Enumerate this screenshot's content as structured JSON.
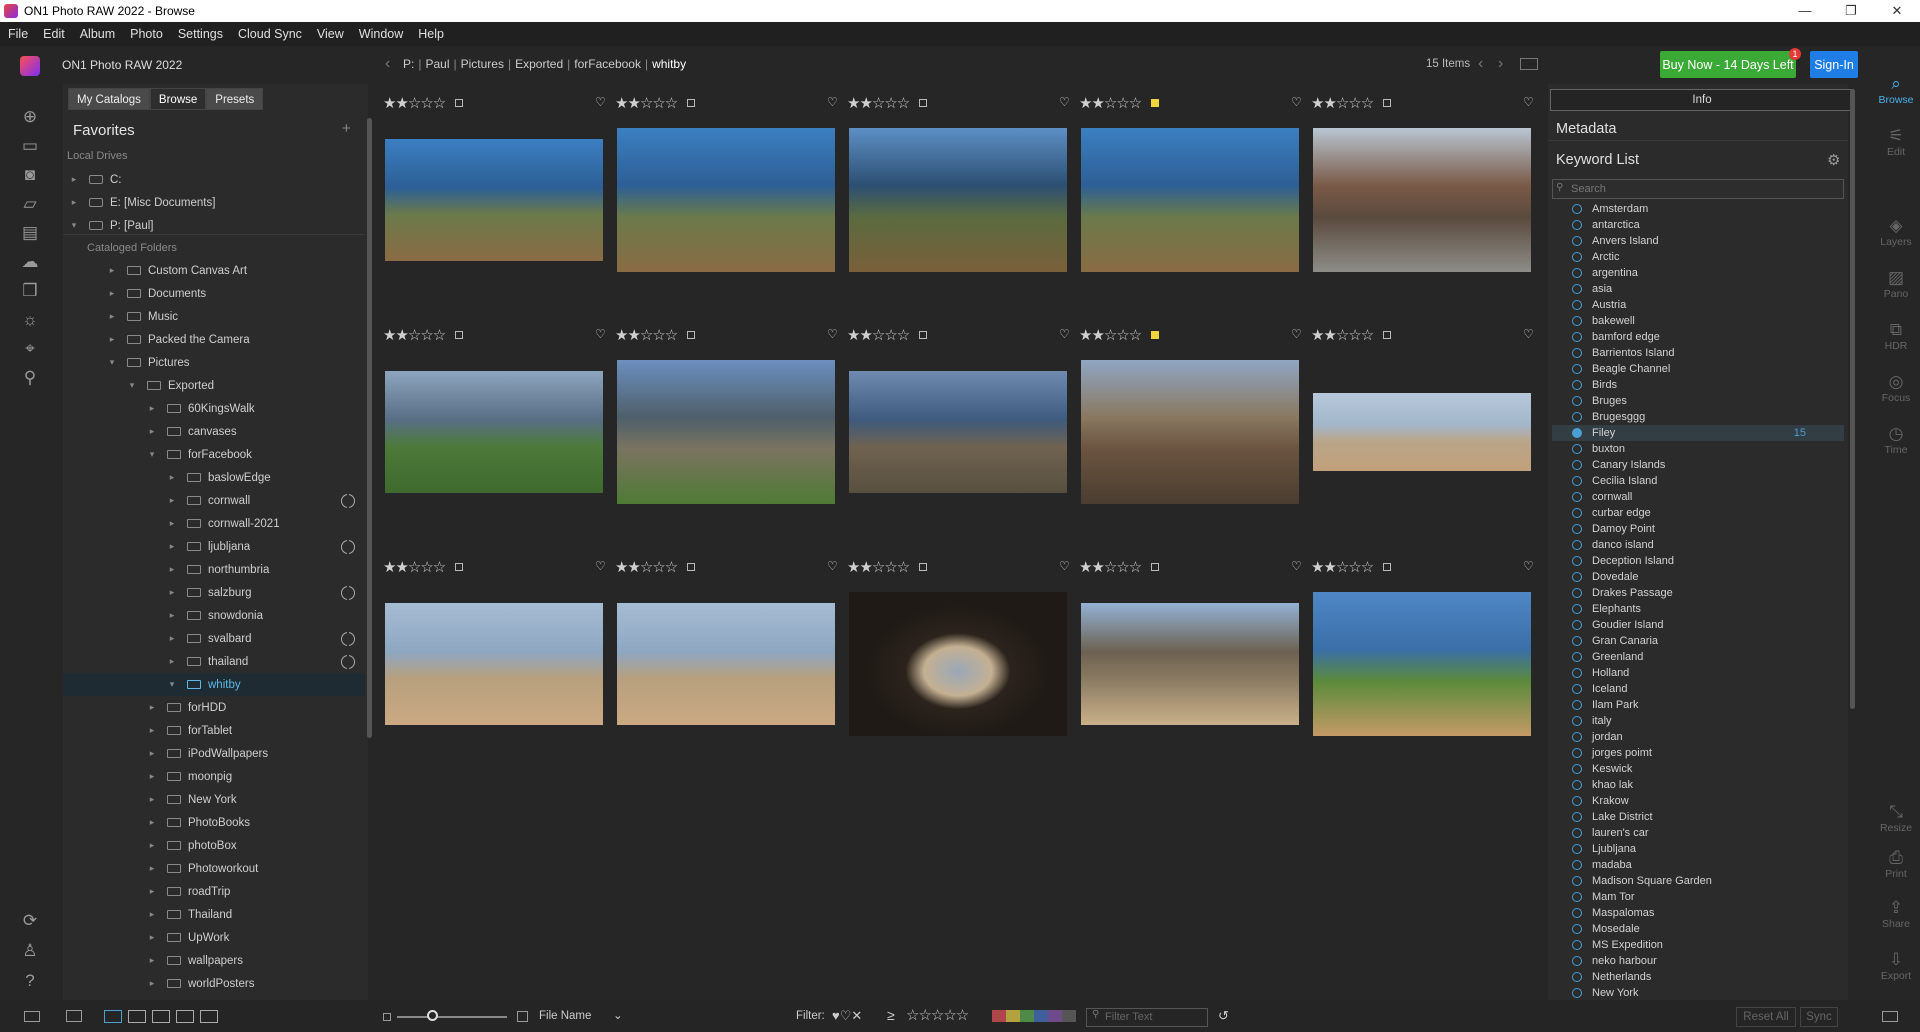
{
  "window": {
    "title": "ON1 Photo RAW 2022 - Browse",
    "controls": [
      "—",
      "❐",
      "✕"
    ]
  },
  "menu": [
    "File",
    "Edit",
    "Album",
    "Photo",
    "Settings",
    "Cloud Sync",
    "View",
    "Window",
    "Help"
  ],
  "brand": "ON1 Photo RAW 2022",
  "breadcrumb": [
    "P:",
    "Paul",
    "Pictures",
    "Exported",
    "forFacebook",
    "whitby"
  ],
  "items_count": "15 Items",
  "buy_button": "Buy Now - 14 Days Left",
  "buy_badge": "1",
  "signin_button": "Sign-In",
  "left_tabs": [
    "My Catalogs",
    "Browse",
    "Presets"
  ],
  "favorites_title": "Favorites",
  "local_drives_label": "Local Drives",
  "drives": [
    "C:",
    "E: [Misc Documents]",
    "P: [Paul]"
  ],
  "cataloged_label": "Cataloged Folders",
  "folders": [
    {
      "label": "Custom Canvas Art",
      "level": 1,
      "open": false,
      "sync": false,
      "selected": false
    },
    {
      "label": "Documents",
      "level": 1,
      "open": false,
      "sync": false,
      "selected": false
    },
    {
      "label": "Music",
      "level": 1,
      "open": false,
      "sync": false,
      "selected": false
    },
    {
      "label": "Packed the Camera",
      "level": 1,
      "open": false,
      "sync": false,
      "selected": false
    },
    {
      "label": "Pictures",
      "level": 1,
      "open": true,
      "sync": false,
      "selected": false
    },
    {
      "label": "Exported",
      "level": 2,
      "open": true,
      "sync": false,
      "selected": false
    },
    {
      "label": "60KingsWalk",
      "level": 3,
      "open": false,
      "sync": false,
      "selected": false
    },
    {
      "label": "canvases",
      "level": 3,
      "open": false,
      "sync": false,
      "selected": false
    },
    {
      "label": "forFacebook",
      "level": 3,
      "open": true,
      "sync": false,
      "selected": false
    },
    {
      "label": "baslowEdge",
      "level": 4,
      "open": false,
      "sync": false,
      "selected": false
    },
    {
      "label": "cornwall",
      "level": 4,
      "open": false,
      "sync": true,
      "selected": false
    },
    {
      "label": "cornwall-2021",
      "level": 4,
      "open": false,
      "sync": false,
      "selected": false
    },
    {
      "label": "ljubljana",
      "level": 4,
      "open": false,
      "sync": true,
      "selected": false
    },
    {
      "label": "northumbria",
      "level": 4,
      "open": false,
      "sync": false,
      "selected": false
    },
    {
      "label": "salzburg",
      "level": 4,
      "open": false,
      "sync": true,
      "selected": false
    },
    {
      "label": "snowdonia",
      "level": 4,
      "open": false,
      "sync": false,
      "selected": false
    },
    {
      "label": "svalbard",
      "level": 4,
      "open": false,
      "sync": true,
      "selected": false
    },
    {
      "label": "thailand",
      "level": 4,
      "open": false,
      "sync": true,
      "selected": false
    },
    {
      "label": "whitby",
      "level": 4,
      "open": true,
      "sync": false,
      "selected": true
    },
    {
      "label": "forHDD",
      "level": 3,
      "open": false,
      "sync": false,
      "selected": false
    },
    {
      "label": "forTablet",
      "level": 3,
      "open": false,
      "sync": false,
      "selected": false
    },
    {
      "label": "iPodWallpapers",
      "level": 3,
      "open": false,
      "sync": false,
      "selected": false
    },
    {
      "label": "moonpig",
      "level": 3,
      "open": false,
      "sync": false,
      "selected": false
    },
    {
      "label": "New York",
      "level": 3,
      "open": false,
      "sync": false,
      "selected": false
    },
    {
      "label": "PhotoBooks",
      "level": 3,
      "open": false,
      "sync": false,
      "selected": false
    },
    {
      "label": "photoBox",
      "level": 3,
      "open": false,
      "sync": false,
      "selected": false
    },
    {
      "label": "Photoworkout",
      "level": 3,
      "open": false,
      "sync": false,
      "selected": false
    },
    {
      "label": "roadTrip",
      "level": 3,
      "open": false,
      "sync": false,
      "selected": false
    },
    {
      "label": "Thailand",
      "level": 3,
      "open": false,
      "sync": false,
      "selected": false
    },
    {
      "label": "UpWork",
      "level": 3,
      "open": false,
      "sync": false,
      "selected": false
    },
    {
      "label": "wallpapers",
      "level": 3,
      "open": false,
      "sync": false,
      "selected": false
    },
    {
      "label": "worldPosters",
      "level": 3,
      "open": false,
      "sync": false,
      "selected": false
    }
  ],
  "photos": [
    {
      "stars": 2,
      "flag": false,
      "color_label": "none",
      "scene": "cliffs-sea"
    },
    {
      "stars": 2,
      "flag": false,
      "color_label": "none",
      "scene": "cliffs-sea"
    },
    {
      "stars": 2,
      "flag": false,
      "color_label": "none",
      "scene": "headland"
    },
    {
      "stars": 2,
      "flag": false,
      "color_label": "yellow",
      "scene": "cliffs-sea"
    },
    {
      "stars": 2,
      "flag": false,
      "color_label": "none",
      "scene": "street"
    },
    {
      "stars": 2,
      "flag": false,
      "color_label": "none",
      "scene": "harbour"
    },
    {
      "stars": 2,
      "flag": false,
      "color_label": "none",
      "scene": "path"
    },
    {
      "stars": 2,
      "flag": false,
      "color_label": "none",
      "scene": "rocky-shore"
    },
    {
      "stars": 2,
      "flag": false,
      "color_label": "yellow",
      "scene": "pier"
    },
    {
      "stars": 2,
      "flag": false,
      "color_label": "none",
      "scene": "beach-wide"
    },
    {
      "stars": 2,
      "flag": false,
      "color_label": "none",
      "scene": "beach"
    },
    {
      "stars": 2,
      "flag": false,
      "color_label": "none",
      "scene": "beach"
    },
    {
      "stars": 2,
      "flag": false,
      "color_label": "none",
      "scene": "bunker-window"
    },
    {
      "stars": 2,
      "flag": false,
      "color_label": "none",
      "scene": "bunker"
    },
    {
      "stars": 2,
      "flag": false,
      "color_label": "none",
      "scene": "bay"
    }
  ],
  "info_tab": "Info",
  "metadata_title": "Metadata",
  "keyword_title": "Keyword List",
  "keyword_search_placeholder": "Search",
  "keywords": [
    {
      "label": "Amsterdam"
    },
    {
      "label": "antarctica"
    },
    {
      "label": "Anvers Island"
    },
    {
      "label": "Arctic"
    },
    {
      "label": "argentina"
    },
    {
      "label": "asia"
    },
    {
      "label": "Austria"
    },
    {
      "label": "bakewell"
    },
    {
      "label": "bamford edge"
    },
    {
      "label": "Barrientos Island"
    },
    {
      "label": "Beagle Channel"
    },
    {
      "label": "Birds"
    },
    {
      "label": "Bruges"
    },
    {
      "label": "Brugesggg"
    },
    {
      "label": "Filey",
      "count": "15",
      "selected": true
    },
    {
      "label": "buxton"
    },
    {
      "label": "Canary Islands"
    },
    {
      "label": "Cecilia Island"
    },
    {
      "label": "cornwall"
    },
    {
      "label": "curbar edge"
    },
    {
      "label": "Damoy Point"
    },
    {
      "label": "danco island"
    },
    {
      "label": "Deception Island"
    },
    {
      "label": "Dovedale"
    },
    {
      "label": "Drakes Passage"
    },
    {
      "label": "Elephants"
    },
    {
      "label": "Goudier Island"
    },
    {
      "label": "Gran Canaria"
    },
    {
      "label": "Greenland"
    },
    {
      "label": "Holland"
    },
    {
      "label": "Iceland"
    },
    {
      "label": "Ilam Park"
    },
    {
      "label": "italy"
    },
    {
      "label": "jordan"
    },
    {
      "label": "jorges poimt"
    },
    {
      "label": "Keswick"
    },
    {
      "label": "khao lak"
    },
    {
      "label": "Krakow"
    },
    {
      "label": "Lake District"
    },
    {
      "label": "lauren's car"
    },
    {
      "label": "Ljubljana"
    },
    {
      "label": "madaba"
    },
    {
      "label": "Madison Square Garden"
    },
    {
      "label": "Mam Tor"
    },
    {
      "label": "Maspalomas"
    },
    {
      "label": "Mosedale"
    },
    {
      "label": "MS Expedition"
    },
    {
      "label": "neko harbour"
    },
    {
      "label": "Netherlands"
    },
    {
      "label": "New York"
    }
  ],
  "right_rail": [
    {
      "label": "Browse",
      "icon": "browse-icon",
      "active": true
    },
    {
      "label": "Edit",
      "icon": "sliders-icon",
      "active": false
    },
    {
      "label": "Layers",
      "icon": "layers-icon",
      "active": false
    },
    {
      "label": "Pano",
      "icon": "pano-icon",
      "active": false
    },
    {
      "label": "HDR",
      "icon": "hdr-icon",
      "active": false
    },
    {
      "label": "Focus",
      "icon": "focus-icon",
      "active": false
    },
    {
      "label": "Time",
      "icon": "time-icon",
      "active": false
    },
    {
      "label": "Resize",
      "icon": "resize-icon",
      "active": false
    },
    {
      "label": "Print",
      "icon": "print-icon",
      "active": false
    },
    {
      "label": "Share",
      "icon": "share-icon",
      "active": false
    },
    {
      "label": "Export",
      "icon": "export-icon",
      "active": false
    }
  ],
  "bottom": {
    "sort_label": "File Name",
    "filter_label": "Filter:",
    "filter_placeholder": "Filter Text",
    "reset_all": "Reset All",
    "sync": "Sync",
    "thumbnail_size": 0.33,
    "swatches": [
      "#b0464a",
      "#b3a23d",
      "#4d8a48",
      "#3f5f9a",
      "#6e4a8a",
      "#555555"
    ]
  }
}
